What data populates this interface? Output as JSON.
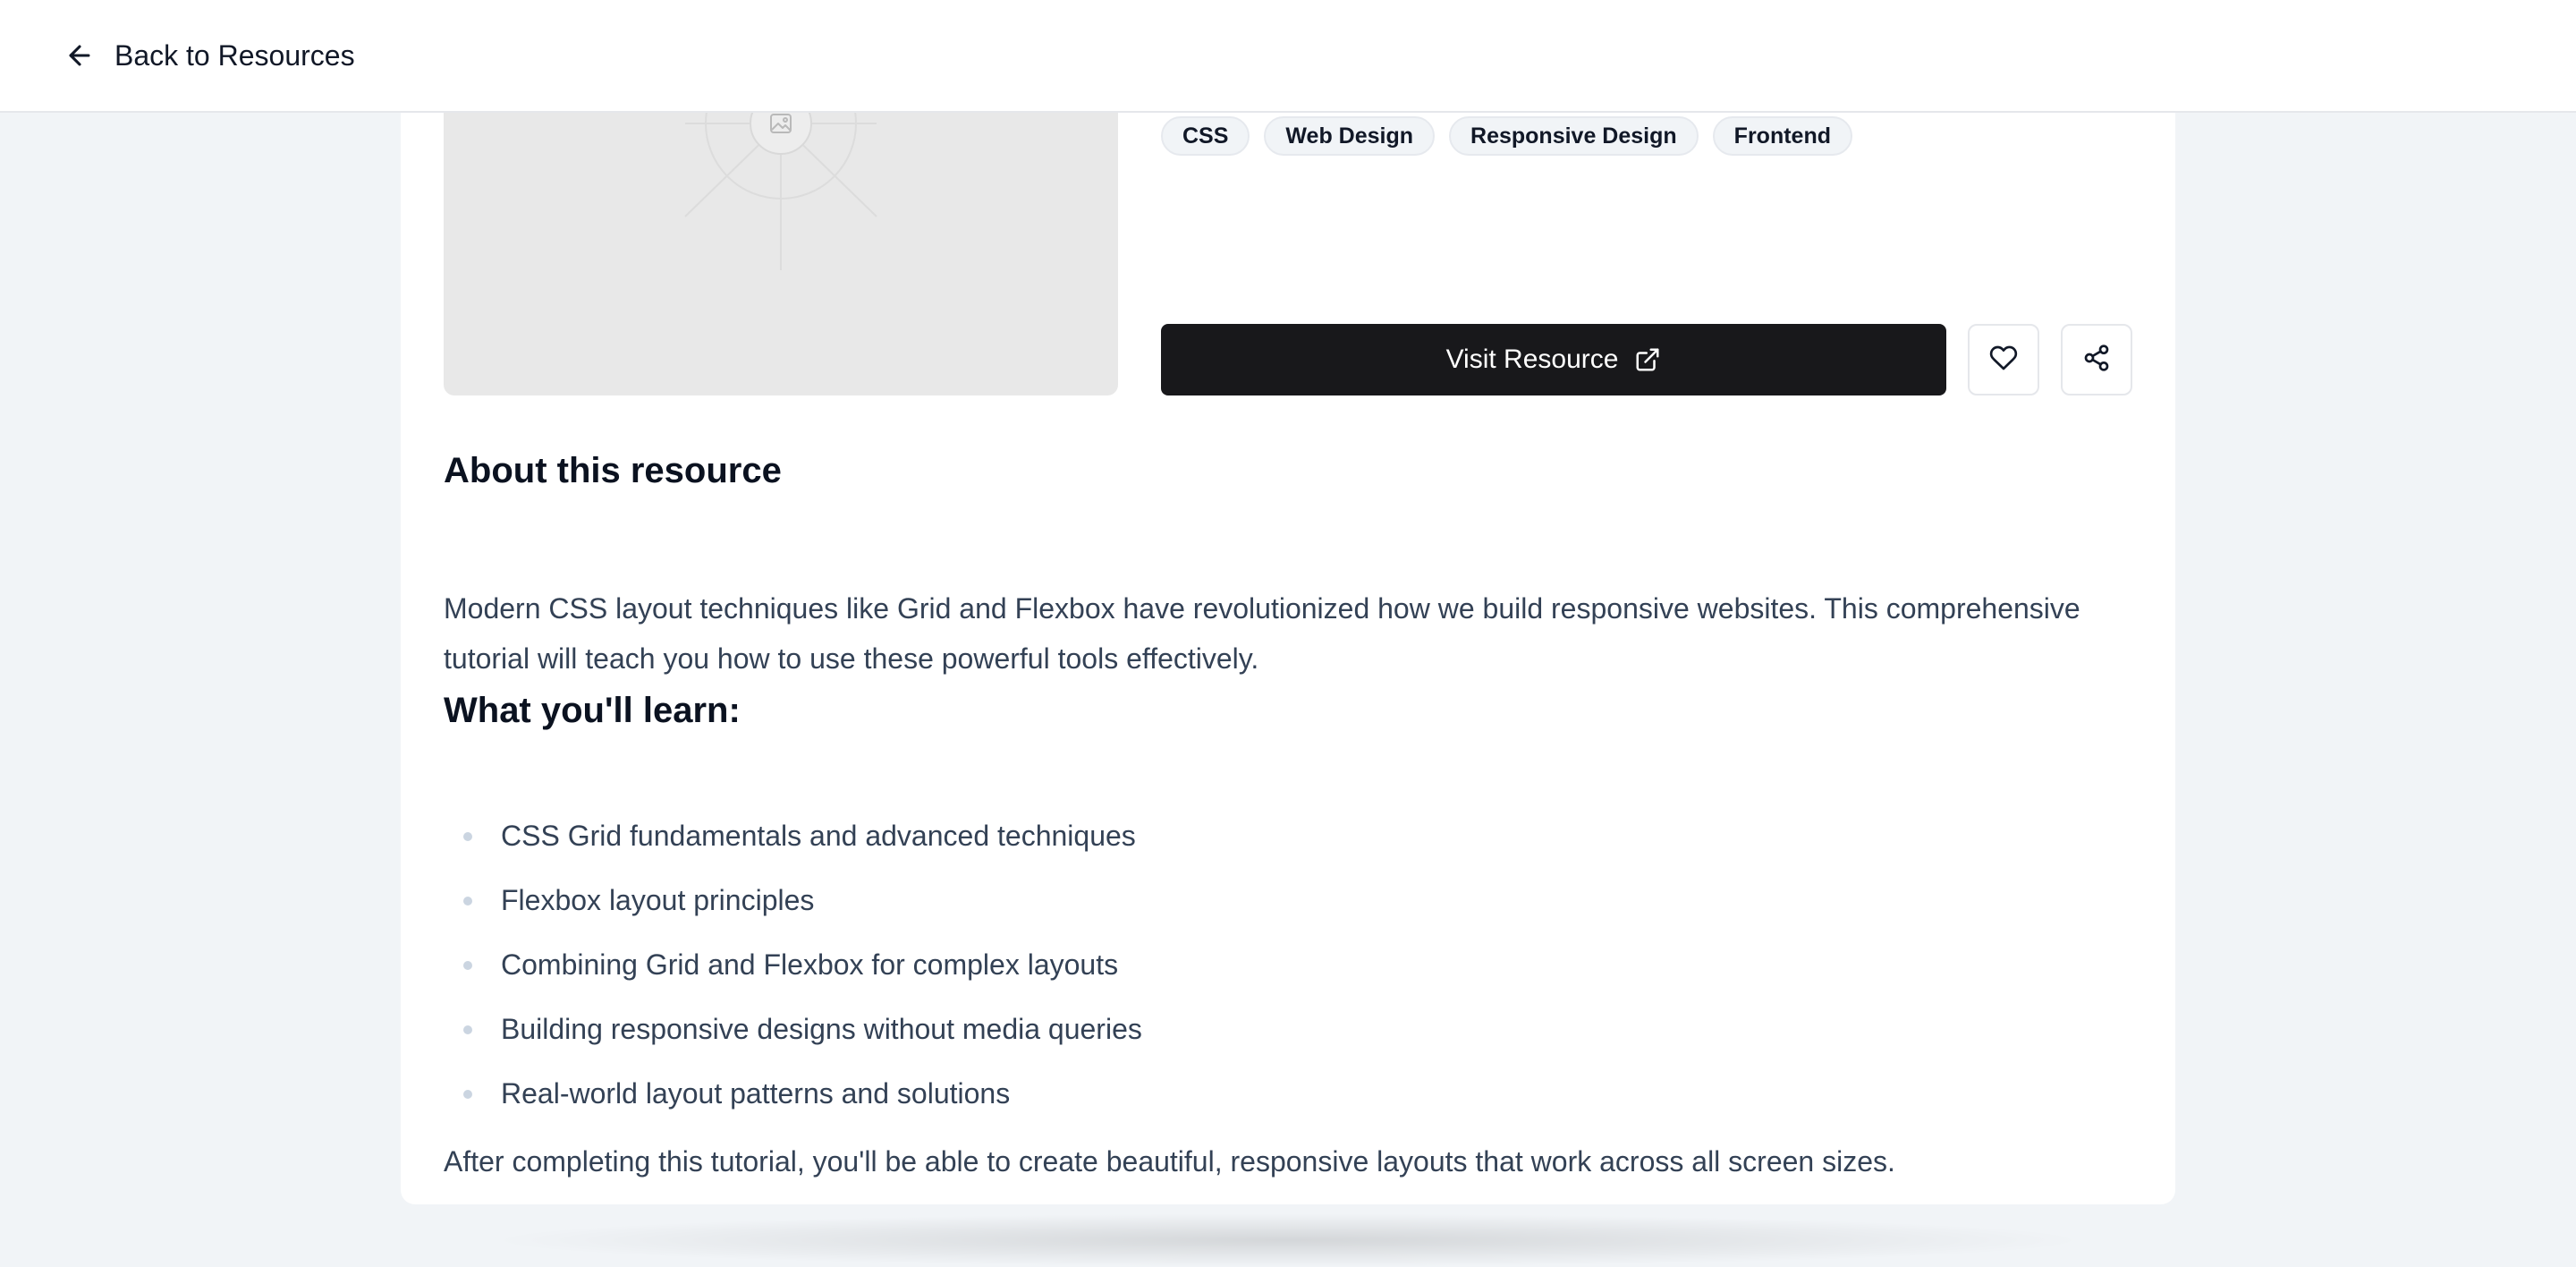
{
  "header": {
    "back_label": "Back to Resources"
  },
  "resource": {
    "tags": [
      "CSS",
      "Web Design",
      "Responsive Design",
      "Frontend"
    ],
    "visit_label": "Visit Resource",
    "about_title": "About this resource",
    "about_text": "Modern CSS layout techniques like Grid and Flexbox have revolutionized how we build responsive websites. This comprehensive tutorial will teach you how to use these powerful tools effectively.",
    "learn_title": "What you'll learn:",
    "learn_items": [
      "CSS Grid fundamentals and advanced techniques",
      "Flexbox layout principles",
      "Combining Grid and Flexbox for complex layouts",
      "Building responsive designs without media queries",
      "Real-world layout patterns and solutions"
    ],
    "closing_text": "After completing this tutorial, you'll be able to create beautiful, responsive layouts that work across all screen sizes."
  },
  "icons": {
    "back": "arrow-left-icon",
    "external": "external-link-icon",
    "like": "heart-icon",
    "share": "share-icon",
    "placeholder": "image-placeholder-icon"
  },
  "colors": {
    "page_bg": "#f1f4f7",
    "primary_button": "#18181b",
    "tag_bg": "#f1f4f7",
    "text": "#334155",
    "heading": "#0b1220"
  }
}
